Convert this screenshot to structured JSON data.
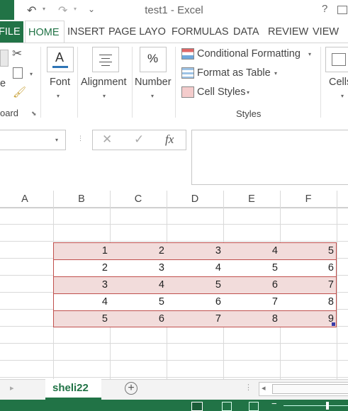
{
  "window": {
    "title": "test1 - Excel",
    "help": "?"
  },
  "tabs": {
    "file": "FILE",
    "home": "HOME",
    "insert": "INSERT",
    "page_layout": "PAGE LAYO",
    "formulas": "FORMULAS",
    "data": "DATA",
    "review": "REVIEW",
    "view": "VIEW"
  },
  "ribbon": {
    "clipboard_label": "oard",
    "paste_partial": "e",
    "font": "Font",
    "alignment": "Alignment",
    "number": "Number",
    "number_glyph": "%",
    "conditional_formatting": "Conditional Formatting",
    "format_as_table": "Format as Table",
    "cell_styles": "Cell Styles",
    "styles_group": "Styles",
    "cells": "Cells"
  },
  "formula_bar": {
    "fx": "fx",
    "cancel": "✕",
    "enter": "✓"
  },
  "columns": [
    "A",
    "B",
    "C",
    "D",
    "E",
    "F"
  ],
  "table": [
    [
      "1",
      "2",
      "3",
      "4",
      "5"
    ],
    [
      "2",
      "3",
      "4",
      "5",
      "6"
    ],
    [
      "3",
      "4",
      "5",
      "6",
      "7"
    ],
    [
      "4",
      "5",
      "6",
      "7",
      "8"
    ],
    [
      "5",
      "6",
      "7",
      "8",
      "9"
    ]
  ],
  "colors": {
    "accent": "#217346",
    "banded_fill": "#f2dcdb",
    "table_border": "#c0504d"
  },
  "sheet": {
    "tab_name": "sheli22",
    "add": "+"
  }
}
